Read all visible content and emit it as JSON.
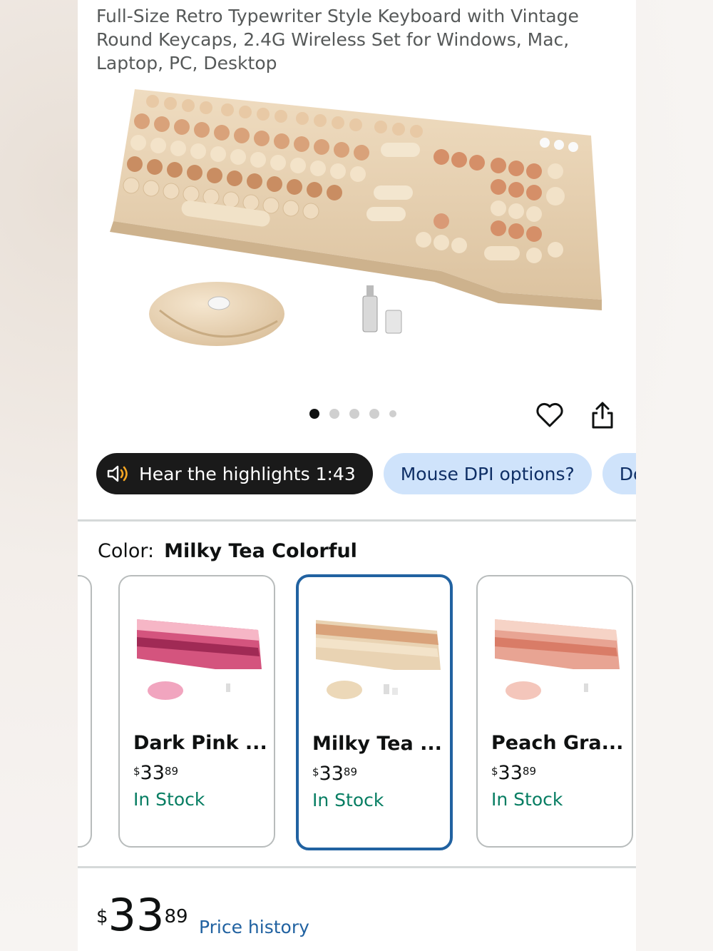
{
  "product": {
    "title": "Full-Size Retro Typewriter Style Keyboard with Vintage Round Keycaps, 2.4G Wireless Set for Windows, Mac, Laptop, PC, Desktop"
  },
  "gallery": {
    "image_count": 5,
    "active_index": 0
  },
  "actions": {
    "wishlist_icon": "heart-icon",
    "share_icon": "share-icon"
  },
  "chips": {
    "audio_label": "Hear the highlights 1:43",
    "q1": "Mouse DPI options?",
    "q2": "Does"
  },
  "color": {
    "label": "Color:",
    "value": "Milky Tea Colorful"
  },
  "variants": [
    {
      "name": "Dark Pink ...",
      "currency": "$",
      "whole": "33",
      "cents": "89",
      "stock": "In Stock",
      "accent": "#d4547e"
    },
    {
      "name": "Milky Tea ...",
      "currency": "$",
      "whole": "33",
      "cents": "89",
      "stock": "In Stock",
      "accent": "#e9d3b3"
    },
    {
      "name": "Peach Gra...",
      "currency": "$",
      "whole": "33",
      "cents": "89",
      "stock": "In Stock",
      "accent": "#e8a493"
    }
  ],
  "price": {
    "currency": "$",
    "whole": "33",
    "cents": "89",
    "history_link": "Price history"
  },
  "colors": {
    "link": "#2162a1",
    "stock": "#067d62",
    "chip_blue": "#cfe3fb",
    "selected_border": "#2162a1"
  }
}
